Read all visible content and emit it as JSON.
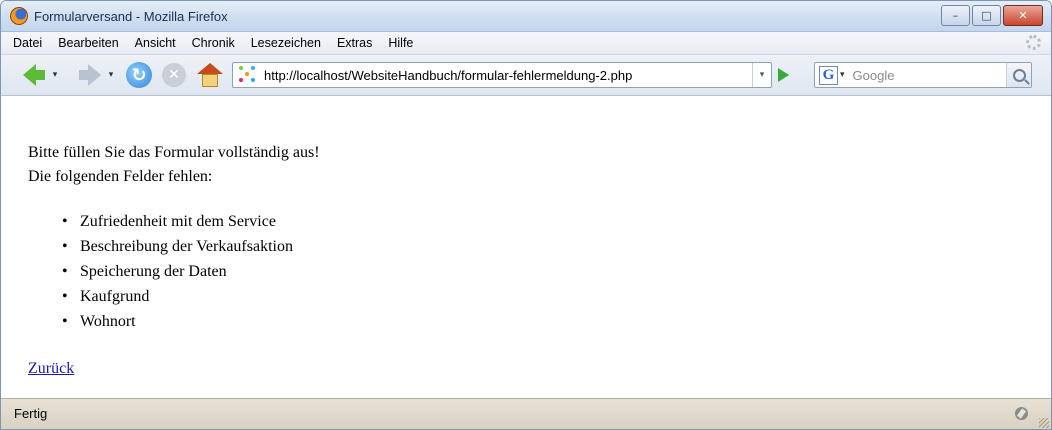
{
  "window": {
    "title": "Formularversand - Mozilla Firefox",
    "controls": {
      "minimize": "–",
      "maximize": "□",
      "close": "✕"
    }
  },
  "menu": {
    "items": [
      {
        "label": "Datei"
      },
      {
        "label": "Bearbeiten"
      },
      {
        "label": "Ansicht"
      },
      {
        "label": "Chronik"
      },
      {
        "label": "Lesezeichen"
      },
      {
        "label": "Extras"
      },
      {
        "label": "Hilfe"
      }
    ]
  },
  "toolbar": {
    "reload_glyph": "↻",
    "stop_glyph": "✕",
    "address": "http://localhost/WebsiteHandbuch/formular-fehlermeldung-2.php",
    "search_engine_letter": "G",
    "search_placeholder": "Google",
    "dropdown_glyph": "▾",
    "icons": [
      "back-icon",
      "forward-icon",
      "reload-icon",
      "stop-icon",
      "home-icon",
      "site-icon",
      "go-icon",
      "google-icon",
      "search-icon"
    ]
  },
  "page": {
    "intro": "Bitte füllen Sie das Formular vollständig aus!",
    "missing_heading": "Die folgenden Felder fehlen:",
    "missing_fields": [
      "Zufriedenheit mit dem Service",
      "Beschreibung der Verkaufsaktion",
      "Speicherung der Daten",
      "Kaufgrund",
      "Wohnort"
    ],
    "back_link": "Zurück"
  },
  "status": {
    "text": "Fertig"
  },
  "colors": {
    "link": "#1a1aa6",
    "go_green": "#39a83a",
    "back_green": "#5dbb3a"
  }
}
